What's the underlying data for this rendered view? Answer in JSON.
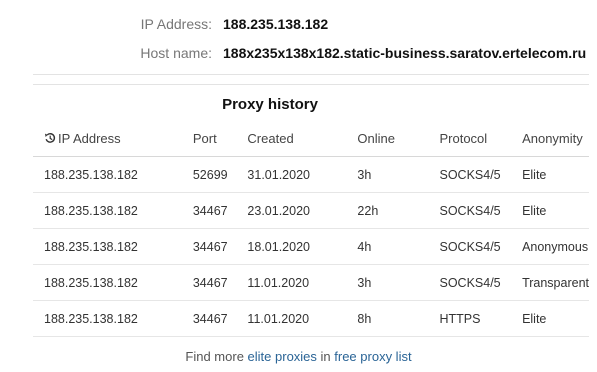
{
  "info": {
    "ip_label": "IP Address:",
    "ip_value": "188.235.138.182",
    "host_label": "Host name:",
    "host_value": "188x235x138x182.static-business.saratov.ertelecom.ru"
  },
  "history": {
    "title": "Proxy history",
    "columns": [
      "IP Address",
      "Port",
      "Created",
      "Online",
      "Protocol",
      "Anonymity"
    ],
    "rows": [
      [
        "188.235.138.182",
        "52699",
        "31.01.2020",
        "3h",
        "SOCKS4/5",
        "Elite"
      ],
      [
        "188.235.138.182",
        "34467",
        "23.01.2020",
        "22h",
        "SOCKS4/5",
        "Elite"
      ],
      [
        "188.235.138.182",
        "34467",
        "18.01.2020",
        "4h",
        "SOCKS4/5",
        "Anonymous"
      ],
      [
        "188.235.138.182",
        "34467",
        "11.01.2020",
        "3h",
        "SOCKS4/5",
        "Transparent"
      ],
      [
        "188.235.138.182",
        "34467",
        "11.01.2020",
        "8h",
        "HTTPS",
        "Elite"
      ]
    ]
  },
  "footer": {
    "prefix": "Find more ",
    "link1": "elite proxies",
    "middle": " in ",
    "link2": "free proxy list"
  },
  "icons": {
    "history": "history-icon"
  },
  "colors": {
    "link": "#2a6496"
  }
}
